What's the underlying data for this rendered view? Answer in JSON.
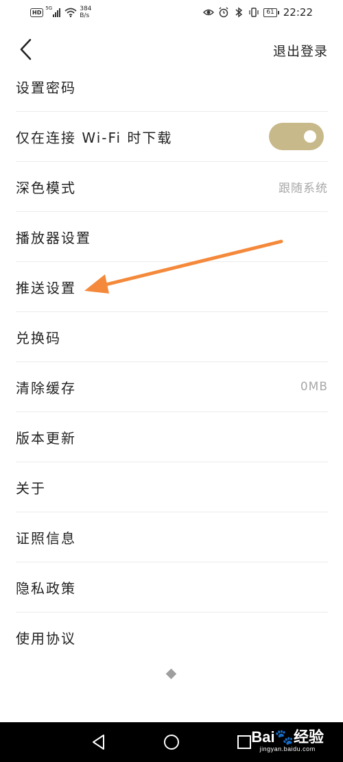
{
  "status_bar": {
    "hd_badge": "HD",
    "signal_label": "5G",
    "net_speed_value": "384",
    "net_speed_unit": "B/s",
    "battery_level": "61",
    "time": "22:22"
  },
  "nav": {
    "back_icon": "chevron-left-icon",
    "logout_label": "退出登录"
  },
  "settings": {
    "items": [
      {
        "label": "设置密码"
      },
      {
        "label": "仅在连接 Wi-Fi 时下载",
        "toggle_on": true
      },
      {
        "label": "深色模式",
        "value": "跟随系统"
      },
      {
        "label": "播放器设置"
      },
      {
        "label": "推送设置"
      },
      {
        "label": "兑换码"
      },
      {
        "label": "清除缓存",
        "value": "0MB"
      },
      {
        "label": "版本更新"
      },
      {
        "label": "关于"
      },
      {
        "label": "证照信息"
      },
      {
        "label": "隐私政策"
      },
      {
        "label": "使用协议"
      }
    ]
  },
  "colors": {
    "toggle_on": "#c8b98a",
    "annotation_arrow": "#f5893b",
    "secondary_text": "#a8a8a8",
    "system_nav_bg": "#000000"
  },
  "watermark": {
    "logo_text": "Bai",
    "logo_suffix": "经验",
    "url": "jingyan.baidu.com"
  }
}
